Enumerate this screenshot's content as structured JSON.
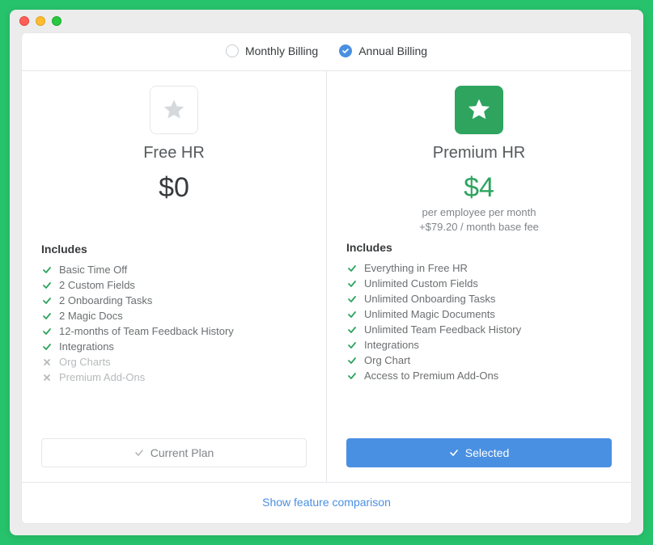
{
  "billing": {
    "monthly_label": "Monthly Billing",
    "annual_label": "Annual Billing",
    "selected": "annual"
  },
  "plans": {
    "free": {
      "title": "Free HR",
      "price": "$0",
      "includes_label": "Includes",
      "features": [
        {
          "label": "Basic Time Off",
          "enabled": true
        },
        {
          "label": "2 Custom Fields",
          "enabled": true
        },
        {
          "label": "2 Onboarding Tasks",
          "enabled": true
        },
        {
          "label": "2 Magic Docs",
          "enabled": true
        },
        {
          "label": "12-months of Team Feedback History",
          "enabled": true
        },
        {
          "label": "Integrations",
          "enabled": true
        },
        {
          "label": "Org Charts",
          "enabled": false
        },
        {
          "label": "Premium Add-Ons",
          "enabled": false
        }
      ],
      "button_label": "Current Plan"
    },
    "premium": {
      "title": "Premium HR",
      "price": "$4",
      "sub1": "per employee per month",
      "sub2": "+$79.20 / month base fee",
      "includes_label": "Includes",
      "features": [
        {
          "label": "Everything in Free HR",
          "enabled": true
        },
        {
          "label": "Unlimited Custom Fields",
          "enabled": true
        },
        {
          "label": "Unlimited Onboarding Tasks",
          "enabled": true
        },
        {
          "label": "Unlimited Magic Documents",
          "enabled": true
        },
        {
          "label": "Unlimited Team Feedback History",
          "enabled": true
        },
        {
          "label": "Integrations",
          "enabled": true
        },
        {
          "label": "Org Chart",
          "enabled": true
        },
        {
          "label": "Access to Premium Add-Ons",
          "enabled": true
        }
      ],
      "button_label": "Selected"
    }
  },
  "footer": {
    "link_label": "Show feature comparison"
  },
  "colors": {
    "accent_green": "#2ea45f",
    "accent_blue": "#4a90e2",
    "page_bg": "#27c26c"
  },
  "icons": {
    "star": "star-icon",
    "check": "check-icon",
    "x": "x-icon"
  }
}
